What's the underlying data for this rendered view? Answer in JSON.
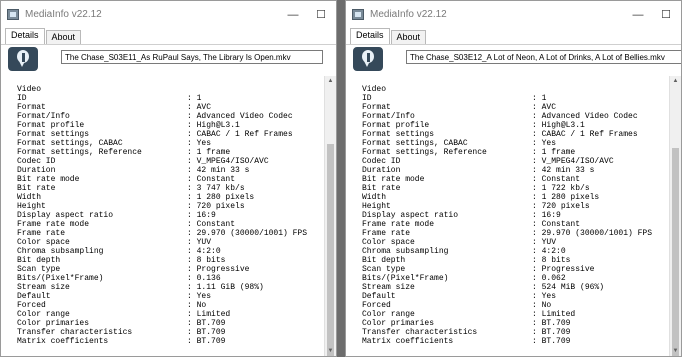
{
  "windows": [
    {
      "title": "MediaInfo v22.12",
      "tabs": [
        "Details",
        "About"
      ],
      "filename": "The Chase_S03E11_As RuPaul Says, The Library Is Open.mkv",
      "section": "Video",
      "rows": [
        [
          "ID",
          "1"
        ],
        [
          "Format",
          "AVC"
        ],
        [
          "Format/Info",
          "Advanced Video Codec"
        ],
        [
          "Format profile",
          "High@L3.1"
        ],
        [
          "Format settings",
          "CABAC / 1 Ref Frames"
        ],
        [
          "Format settings, CABAC",
          "Yes"
        ],
        [
          "Format settings, Reference",
          "1 frame"
        ],
        [
          "Codec ID",
          "V_MPEG4/ISO/AVC"
        ],
        [
          "Duration",
          "42 min 33 s"
        ],
        [
          "Bit rate mode",
          "Constant"
        ],
        [
          "Bit rate",
          "3 747 kb/s"
        ],
        [
          "Width",
          "1 280 pixels"
        ],
        [
          "Height",
          "720 pixels"
        ],
        [
          "Display aspect ratio",
          "16:9"
        ],
        [
          "Frame rate mode",
          "Constant"
        ],
        [
          "Frame rate",
          "29.970 (30000/1001) FPS"
        ],
        [
          "Color space",
          "YUV"
        ],
        [
          "Chroma subsampling",
          "4:2:0"
        ],
        [
          "Bit depth",
          "8 bits"
        ],
        [
          "Scan type",
          "Progressive"
        ],
        [
          "Bits/(Pixel*Frame)",
          "0.136"
        ],
        [
          "Stream size",
          "1.11 GiB (98%)"
        ],
        [
          "Default",
          "Yes"
        ],
        [
          "Forced",
          "No"
        ],
        [
          "Color range",
          "Limited"
        ],
        [
          "Color primaries",
          "BT.709"
        ],
        [
          "Transfer characteristics",
          "BT.709"
        ],
        [
          "Matrix coefficients",
          "BT.709"
        ]
      ]
    },
    {
      "title": "MediaInfo v22.12",
      "tabs": [
        "Details",
        "About"
      ],
      "filename": "The Chase_S03E12_A Lot of Neon, A Lot of Drinks, A Lot of Bellies.mkv",
      "section": "Video",
      "rows": [
        [
          "ID",
          "1"
        ],
        [
          "Format",
          "AVC"
        ],
        [
          "Format/Info",
          "Advanced Video Codec"
        ],
        [
          "Format profile",
          "High@L3.1"
        ],
        [
          "Format settings",
          "CABAC / 1 Ref Frames"
        ],
        [
          "Format settings, CABAC",
          "Yes"
        ],
        [
          "Format settings, Reference",
          "1 frame"
        ],
        [
          "Codec ID",
          "V_MPEG4/ISO/AVC"
        ],
        [
          "Duration",
          "42 min 33 s"
        ],
        [
          "Bit rate mode",
          "Constant"
        ],
        [
          "Bit rate",
          "1 722 kb/s"
        ],
        [
          "Width",
          "1 280 pixels"
        ],
        [
          "Height",
          "720 pixels"
        ],
        [
          "Display aspect ratio",
          "16:9"
        ],
        [
          "Frame rate mode",
          "Constant"
        ],
        [
          "Frame rate",
          "29.970 (30000/1001) FPS"
        ],
        [
          "Color space",
          "YUV"
        ],
        [
          "Chroma subsampling",
          "4:2:0"
        ],
        [
          "Bit depth",
          "8 bits"
        ],
        [
          "Scan type",
          "Progressive"
        ],
        [
          "Bits/(Pixel*Frame)",
          "0.062"
        ],
        [
          "Stream size",
          "524 MiB (96%)"
        ],
        [
          "Default",
          "Yes"
        ],
        [
          "Forced",
          "No"
        ],
        [
          "Color range",
          "Limited"
        ],
        [
          "Color primaries",
          "BT.709"
        ],
        [
          "Transfer characteristics",
          "BT.709"
        ],
        [
          "Matrix coefficients",
          "BT.709"
        ]
      ]
    }
  ],
  "controls": {
    "minimize": "—",
    "maximize": "☐"
  },
  "scroll": {
    "up": "▲",
    "down": "▼"
  },
  "colors": {
    "desktop": "#6d6d6d",
    "logo": "#35495a"
  }
}
